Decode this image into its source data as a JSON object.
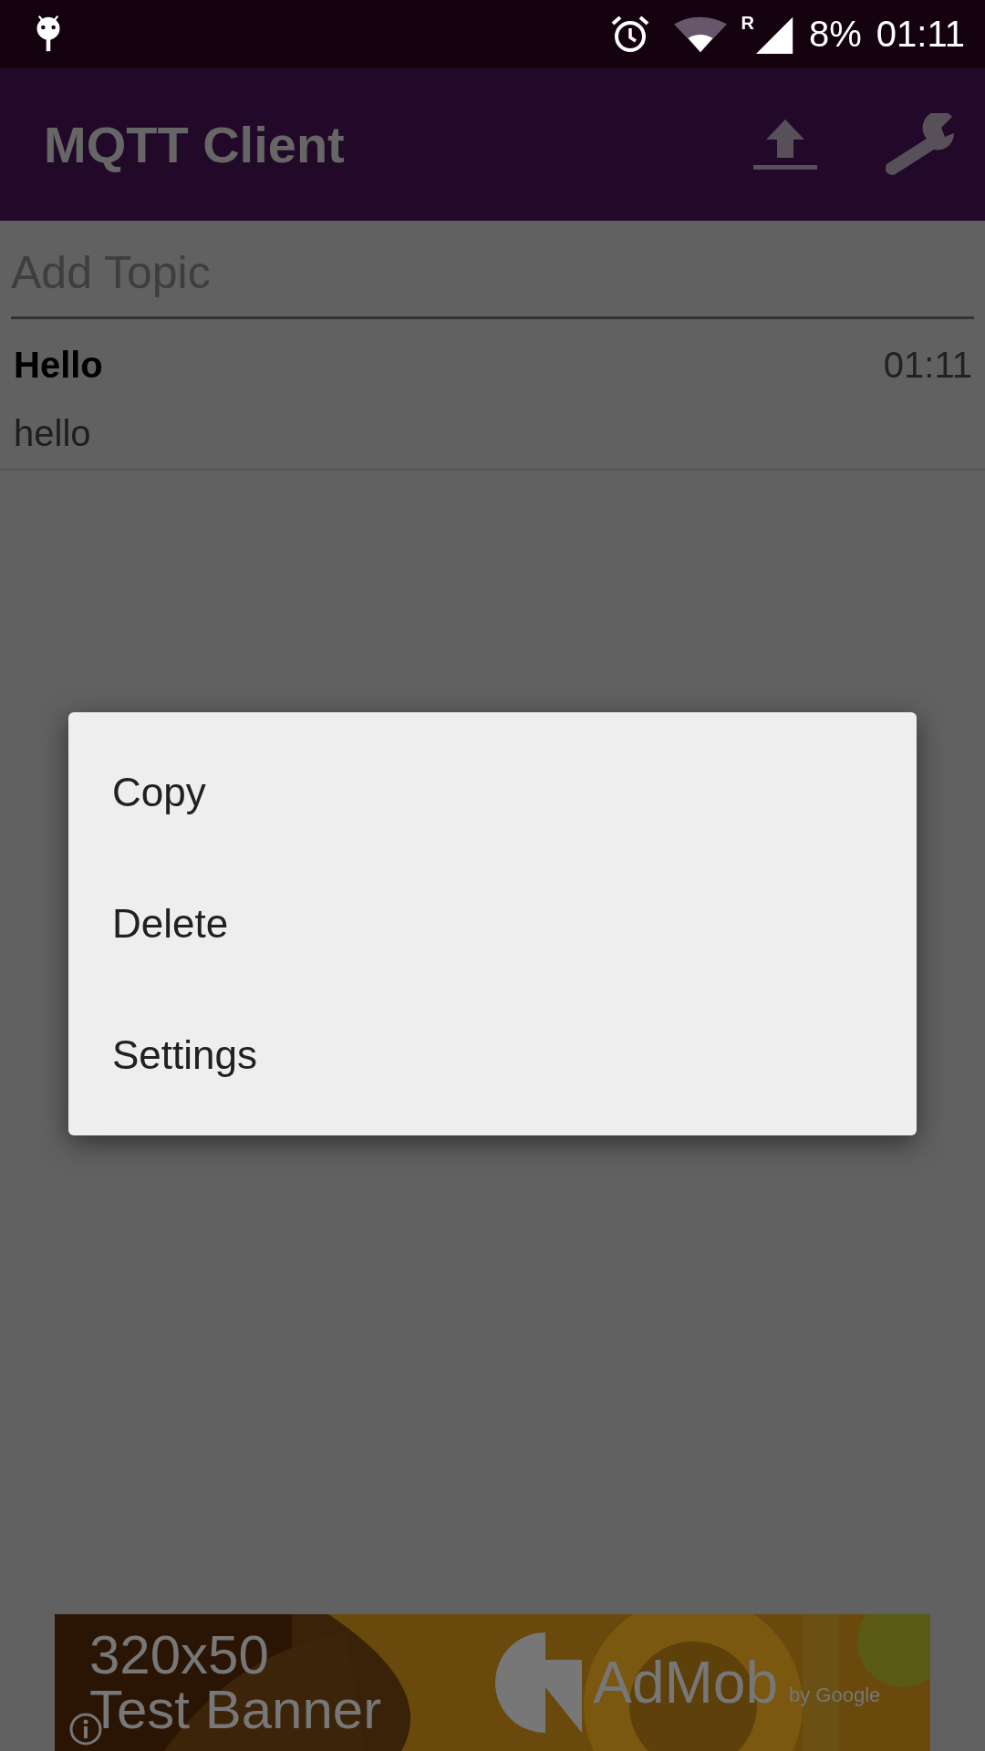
{
  "status_bar": {
    "roaming": "R",
    "battery": "8%",
    "time": "01:11"
  },
  "app_bar": {
    "title": "MQTT Client"
  },
  "topic_field": {
    "placeholder": "Add Topic"
  },
  "messages": [
    {
      "topic": "Hello",
      "time": "01:11",
      "body": "hello"
    }
  ],
  "context_menu": {
    "items": [
      "Copy",
      "Delete",
      "Settings"
    ]
  },
  "ad_banner": {
    "size": "320x50",
    "label": "Test Banner",
    "brand": "AdMob",
    "byline": "by Google"
  }
}
